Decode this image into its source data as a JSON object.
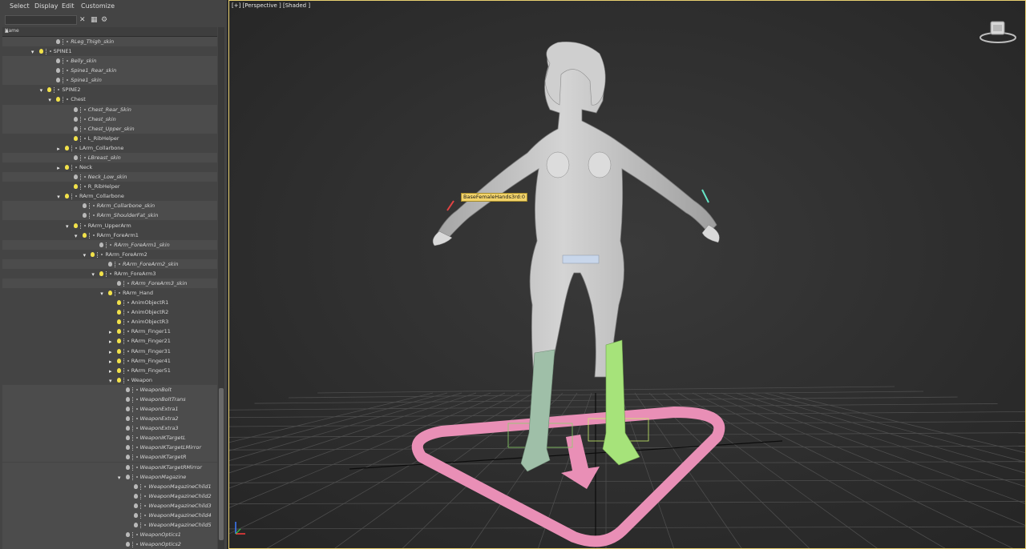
{
  "menu": [
    "Select",
    "Display",
    "Edit",
    "Customize"
  ],
  "scene_explorer": {
    "search": {
      "value": "",
      "placeholder": ""
    },
    "column_header": "Name",
    "rows": [
      {
        "label": "RLeg_Thigh_skin",
        "indent": 4,
        "expander": "",
        "bulb": "off",
        "italic": true
      },
      {
        "label": "SPINE1",
        "indent": 2,
        "expander": "down",
        "bulb": "on",
        "italic": false
      },
      {
        "label": "Belly_skin",
        "indent": 4,
        "expander": "",
        "bulb": "off",
        "italic": true
      },
      {
        "label": "Spine1_Rear_skin",
        "indent": 4,
        "expander": "",
        "bulb": "off",
        "italic": true
      },
      {
        "label": "Spine1_skin",
        "indent": 4,
        "expander": "",
        "bulb": "off",
        "italic": true
      },
      {
        "label": "SPINE2",
        "indent": 3,
        "expander": "down",
        "bulb": "on",
        "italic": false
      },
      {
        "label": "Chest",
        "indent": 4,
        "expander": "down",
        "bulb": "on",
        "italic": false
      },
      {
        "label": "Chest_Rear_Skin",
        "indent": 6,
        "expander": "",
        "bulb": "off",
        "italic": true
      },
      {
        "label": "Chest_skin",
        "indent": 6,
        "expander": "",
        "bulb": "off",
        "italic": true
      },
      {
        "label": "Chest_Upper_skin",
        "indent": 6,
        "expander": "",
        "bulb": "off",
        "italic": true
      },
      {
        "label": "L_RibHelper",
        "indent": 6,
        "expander": "",
        "bulb": "on",
        "italic": false
      },
      {
        "label": "LArm_Collarbone",
        "indent": 5,
        "expander": "right",
        "bulb": "on",
        "italic": false
      },
      {
        "label": "LBreast_skin",
        "indent": 6,
        "expander": "",
        "bulb": "off",
        "italic": true
      },
      {
        "label": "Neck",
        "indent": 5,
        "expander": "right",
        "bulb": "on",
        "italic": false
      },
      {
        "label": "Neck_Low_skin",
        "indent": 6,
        "expander": "",
        "bulb": "off",
        "italic": true
      },
      {
        "label": "R_RibHelper",
        "indent": 6,
        "expander": "",
        "bulb": "on",
        "italic": false
      },
      {
        "label": "RArm_Collarbone",
        "indent": 5,
        "expander": "down",
        "bulb": "on",
        "italic": false
      },
      {
        "label": "RArm_Collarbone_skin",
        "indent": 7,
        "expander": "",
        "bulb": "off",
        "italic": true
      },
      {
        "label": "RArm_ShoulderFat_skin",
        "indent": 7,
        "expander": "",
        "bulb": "off",
        "italic": true
      },
      {
        "label": "RArm_UpperArm",
        "indent": 6,
        "expander": "down",
        "bulb": "on",
        "italic": false
      },
      {
        "label": "RArm_ForeArm1",
        "indent": 7,
        "expander": "down",
        "bulb": "on",
        "italic": false
      },
      {
        "label": "RArm_ForeArm1_skin",
        "indent": 9,
        "expander": "",
        "bulb": "off",
        "italic": true
      },
      {
        "label": "RArm_ForeArm2",
        "indent": 8,
        "expander": "down",
        "bulb": "on",
        "italic": false
      },
      {
        "label": "RArm_ForeArm2_skin",
        "indent": 10,
        "expander": "",
        "bulb": "off",
        "italic": true
      },
      {
        "label": "RArm_ForeArm3",
        "indent": 9,
        "expander": "down",
        "bulb": "on",
        "italic": false
      },
      {
        "label": "RArm_ForeArm3_skin",
        "indent": 11,
        "expander": "",
        "bulb": "off",
        "italic": true
      },
      {
        "label": "RArm_Hand",
        "indent": 10,
        "expander": "down",
        "bulb": "on",
        "italic": false
      },
      {
        "label": "AnimObjectR1",
        "indent": 11,
        "expander": "",
        "bulb": "on",
        "italic": false
      },
      {
        "label": "AnimObjectR2",
        "indent": 11,
        "expander": "",
        "bulb": "on",
        "italic": false
      },
      {
        "label": "AnimObjectR3",
        "indent": 11,
        "expander": "",
        "bulb": "on",
        "italic": false
      },
      {
        "label": "RArm_Finger11",
        "indent": 11,
        "expander": "right",
        "bulb": "on",
        "italic": false
      },
      {
        "label": "RArm_Finger21",
        "indent": 11,
        "expander": "right",
        "bulb": "on",
        "italic": false
      },
      {
        "label": "RArm_Finger31",
        "indent": 11,
        "expander": "right",
        "bulb": "on",
        "italic": false
      },
      {
        "label": "RArm_Finger41",
        "indent": 11,
        "expander": "right",
        "bulb": "on",
        "italic": false
      },
      {
        "label": "RArm_Finger51",
        "indent": 11,
        "expander": "right",
        "bulb": "on",
        "italic": false
      },
      {
        "label": "Weapon",
        "indent": 11,
        "expander": "down",
        "bulb": "on",
        "italic": false
      },
      {
        "label": "WeaponBolt",
        "indent": 12,
        "expander": "",
        "bulb": "off",
        "italic": true
      },
      {
        "label": "WeaponBoltTrans",
        "indent": 12,
        "expander": "",
        "bulb": "off",
        "italic": true
      },
      {
        "label": "WeaponExtra1",
        "indent": 12,
        "expander": "",
        "bulb": "off",
        "italic": true
      },
      {
        "label": "WeaponExtra2",
        "indent": 12,
        "expander": "",
        "bulb": "off",
        "italic": true
      },
      {
        "label": "WeaponExtra3",
        "indent": 12,
        "expander": "",
        "bulb": "off",
        "italic": true
      },
      {
        "label": "WeaponIKTargetL",
        "indent": 12,
        "expander": "",
        "bulb": "off",
        "italic": true
      },
      {
        "label": "WeaponIKTargetLMirror",
        "indent": 12,
        "expander": "",
        "bulb": "off",
        "italic": true
      },
      {
        "label": "WeaponIKTargetR",
        "indent": 12,
        "expander": "",
        "bulb": "off",
        "italic": true
      },
      {
        "label": "WeaponIKTargetRMirror",
        "indent": 12,
        "expander": "",
        "bulb": "off",
        "italic": true
      },
      {
        "label": "WeaponMagazine",
        "indent": 12,
        "expander": "down",
        "bulb": "off",
        "italic": true
      },
      {
        "label": "WeaponMagazineChild1",
        "indent": 13,
        "expander": "",
        "bulb": "off",
        "italic": true
      },
      {
        "label": "WeaponMagazineChild2",
        "indent": 13,
        "expander": "",
        "bulb": "off",
        "italic": true
      },
      {
        "label": "WeaponMagazineChild3",
        "indent": 13,
        "expander": "",
        "bulb": "off",
        "italic": true
      },
      {
        "label": "WeaponMagazineChild4",
        "indent": 13,
        "expander": "",
        "bulb": "off",
        "italic": true
      },
      {
        "label": "WeaponMagazineChild5",
        "indent": 13,
        "expander": "",
        "bulb": "off",
        "italic": true
      },
      {
        "label": "WeaponOptics1",
        "indent": 12,
        "expander": "",
        "bulb": "off",
        "italic": true
      },
      {
        "label": "WeaponOptics2",
        "indent": 12,
        "expander": "",
        "bulb": "off",
        "italic": true
      }
    ]
  },
  "viewport": {
    "label": "[+] [Perspective ] [Shaded ]",
    "object_tag": "BaseFemaleHands3rd:0"
  },
  "colors": {
    "viewport_border": "#e8d070",
    "bulb_on": "#f1e14a",
    "control_shape": "#e98fb6",
    "left_leg_mesh": "#9fbfa8",
    "right_leg_mesh": "#a6e37a"
  }
}
